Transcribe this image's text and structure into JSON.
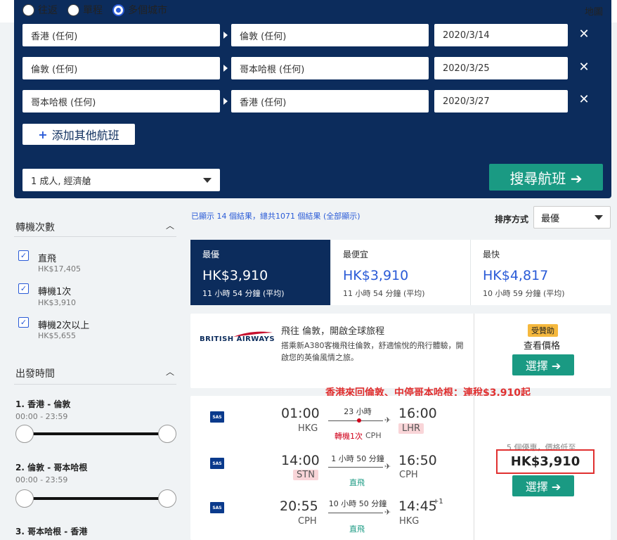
{
  "trip_type": {
    "options": [
      "往返",
      "單程",
      "多個城市"
    ],
    "selected": "多個城市"
  },
  "map_link": "地圖",
  "legs": [
    {
      "from": "香港 (任何)",
      "to": "倫敦 (任何)",
      "date": "2020/3/14",
      "remove": "✕"
    },
    {
      "from": "倫敦 (任何)",
      "to": "哥本哈根 (任何)",
      "date": "2020/3/25",
      "remove": "✕"
    },
    {
      "from": "哥本哈根 (任何)",
      "to": "香港 (任何)",
      "date": "2020/3/27",
      "remove": "✕"
    }
  ],
  "add_flight": "添加其他航班",
  "passengers": "1 成人, 經濟艙",
  "search_button": "搜尋航班 ➔",
  "filters": {
    "stops_title": "轉機次數",
    "stops": [
      {
        "label": "直飛",
        "price": "HK$17,405",
        "checked": "✓"
      },
      {
        "label": "轉機1次",
        "price": "HK$3,910",
        "checked": "✓"
      },
      {
        "label": "轉機2次以上",
        "price": "HK$5,655",
        "checked": "✓"
      }
    ],
    "departure_title": "出發時間",
    "departure": [
      {
        "label": "1. 香港 - 倫敦",
        "range": "00:00 - 23:59"
      },
      {
        "label": "2. 倫敦 - 哥本哈根",
        "range": "00:00 - 23:59"
      },
      {
        "label": "3. 哥本哈根 - 香港",
        "range": ""
      }
    ]
  },
  "results_count": "已顯示 14 個結果，總共1071 個結果 (全部顯示)",
  "sort": {
    "label": "排序方式",
    "value": "最優"
  },
  "tabs": [
    {
      "label": "最優",
      "price": "HK$3,910",
      "duration": "11 小時 54 分鐘 (平均)"
    },
    {
      "label": "最便宜",
      "price": "HK$3,910",
      "duration": "11 小時 54 分鐘 (平均)"
    },
    {
      "label": "最快",
      "price": "HK$4,817",
      "duration": "10 小時 59 分鐘 (平均)"
    }
  ],
  "ad": {
    "logo_text": "BRITISH AIRWAYS",
    "title": "飛往 倫敦，開啟全球旅程",
    "text": "搭乘新A380客機飛往倫敦，舒適愉悅的飛行體驗，開啟您的英倫風情之旅。",
    "sponsored": "受贊助",
    "view_price": "查看價格",
    "choose": "選擇 ➔"
  },
  "annotation": "香港來回倫敦、中停哥本哈根：連稅$3,910起",
  "result": {
    "deal_text": "5 個優惠，價格低至",
    "price": "HK$3,910",
    "choose": "選擇 ➔",
    "airline_logo": "SAS",
    "segments": [
      {
        "dep_time": "01:00",
        "dep_code": "HKG",
        "duration": "23 小時",
        "stops": "轉機1次",
        "stop_code": "CPH",
        "arr_time": "16:00",
        "arr_code": "LHR",
        "day_offset": ""
      },
      {
        "dep_time": "14:00",
        "dep_code": "STN",
        "duration": "1 小時 50 分鐘",
        "stops": "直飛",
        "stop_code": "",
        "arr_time": "16:50",
        "arr_code": "CPH",
        "day_offset": ""
      },
      {
        "dep_time": "20:55",
        "dep_code": "CPH",
        "duration": "10 小時 50 分鐘",
        "stops": "直飛",
        "stop_code": "",
        "arr_time": "14:45",
        "arr_code": "HKG",
        "day_offset": "+1"
      }
    ]
  },
  "colors": {
    "navy": "#0c2c5c",
    "accent_blue": "#2a5bd7",
    "teal": "#1a9a83",
    "annotation_red": "#e03030"
  }
}
